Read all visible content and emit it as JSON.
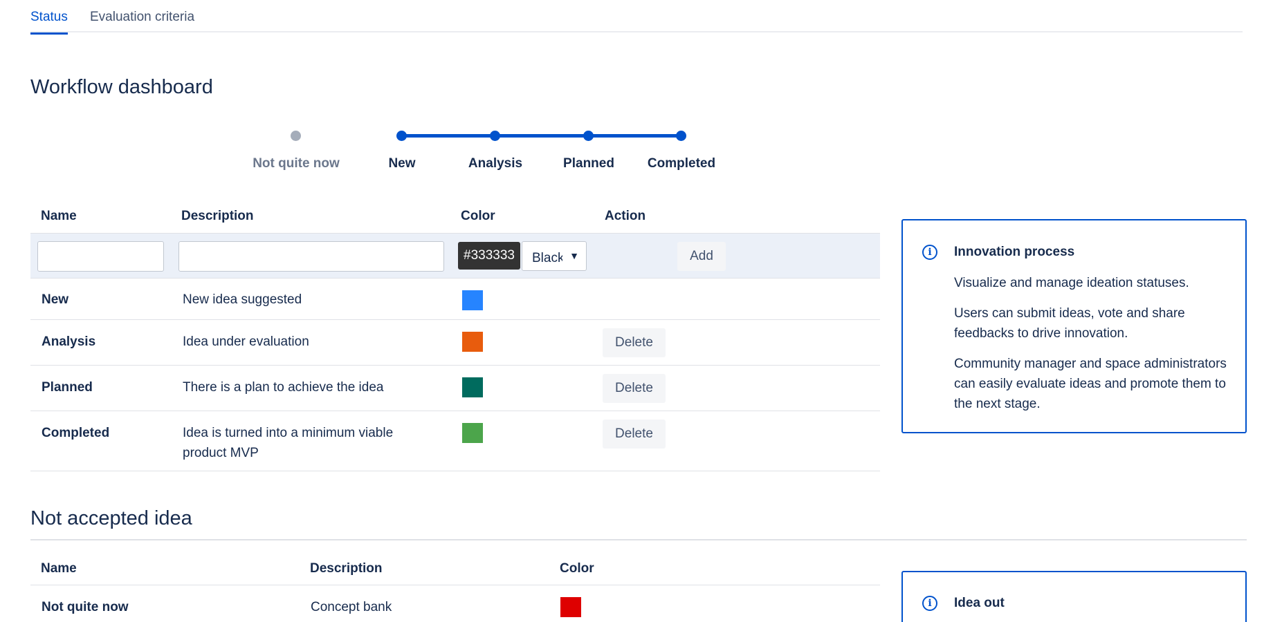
{
  "tabs": [
    {
      "label": "Status",
      "active": true
    },
    {
      "label": "Evaluation criteria",
      "active": false
    }
  ],
  "workflow": {
    "title": "Workflow dashboard",
    "stages": [
      {
        "label": "Not quite now",
        "active": false
      },
      {
        "label": "New",
        "active": true
      },
      {
        "label": "Analysis",
        "active": true
      },
      {
        "label": "Planned",
        "active": true
      },
      {
        "label": "Completed",
        "active": true
      }
    ],
    "accent_color": "#0052cc",
    "inactive_color": "#a5adba"
  },
  "status_table": {
    "headers": {
      "name": "Name",
      "description": "Description",
      "color": "Color",
      "action": "Action"
    },
    "new_row": {
      "name_value": "",
      "description_value": "",
      "color_hex": "#333333",
      "color_name": "Black",
      "add_label": "Add"
    },
    "rows": [
      {
        "name": "New",
        "description": "New idea suggested",
        "color": "#2684ff",
        "action": ""
      },
      {
        "name": "Analysis",
        "description": "Idea under evaluation",
        "color": "#e85c0d",
        "action": "Delete"
      },
      {
        "name": "Planned",
        "description": "There is a plan to achieve the idea",
        "color": "#006b5e",
        "action": "Delete"
      },
      {
        "name": "Completed",
        "description": "Idea is turned into a minimum viable product MVP",
        "color": "#4ca54b",
        "action": "Delete"
      }
    ]
  },
  "innovation_panel": {
    "title": "Innovation process",
    "paragraphs": [
      "Visualize and manage ideation statuses.",
      "Users can submit ideas, vote and share feedbacks to drive innovation.",
      "Community manager and space administrators can easily evaluate ideas and promote them to the next stage."
    ]
  },
  "not_accepted": {
    "title": "Not accepted idea",
    "headers": {
      "name": "Name",
      "description": "Description",
      "color": "Color"
    },
    "rows": [
      {
        "name": "Not quite now",
        "description": "Concept bank",
        "color": "#de0000"
      }
    ]
  },
  "idea_out_panel": {
    "title": "Idea out"
  },
  "icons": {
    "info": "info-icon",
    "dropdown": "chevron-down-icon"
  }
}
